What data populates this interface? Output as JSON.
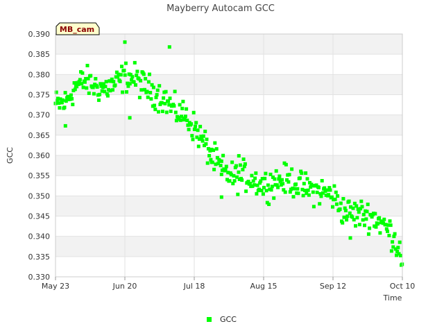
{
  "chart_data": {
    "type": "scatter",
    "title": "Mayberry Autocam GCC",
    "xlabel": "Time",
    "ylabel": "GCC",
    "site_tag": "MB_cam",
    "x_range": [
      "2023-05-23",
      "2023-10-10"
    ],
    "ylim": [
      0.33,
      0.39
    ],
    "y_ticks": [
      "0.330",
      "0.335",
      "0.340",
      "0.345",
      "0.350",
      "0.355",
      "0.360",
      "0.365",
      "0.370",
      "0.375",
      "0.380",
      "0.385",
      "0.390"
    ],
    "x_ticks": [
      {
        "date": "2023-05-23",
        "label": "May 23"
      },
      {
        "date": "2023-06-20",
        "label": "Jun 20"
      },
      {
        "date": "2023-07-18",
        "label": "Jul 18"
      },
      {
        "date": "2023-08-15",
        "label": "Aug 15"
      },
      {
        "date": "2023-09-12",
        "label": "Sep 12"
      },
      {
        "date": "2023-10-10",
        "label": "Oct 10"
      }
    ],
    "grid": true,
    "legend": "bottom-center",
    "colors": {
      "series": "#00ff00",
      "band": "#f2f2f2"
    },
    "series": [
      {
        "name": "GCC",
        "trend": [
          [
            "2023-05-23",
            0.3725
          ],
          [
            "2023-05-27",
            0.373
          ],
          [
            "2023-05-31",
            0.377
          ],
          [
            "2023-06-04",
            0.3785
          ],
          [
            "2023-06-08",
            0.377
          ],
          [
            "2023-06-12",
            0.3765
          ],
          [
            "2023-06-16",
            0.3775
          ],
          [
            "2023-06-20",
            0.3795
          ],
          [
            "2023-06-24",
            0.379
          ],
          [
            "2023-06-28",
            0.377
          ],
          [
            "2023-07-02",
            0.3755
          ],
          [
            "2023-07-06",
            0.374
          ],
          [
            "2023-07-10",
            0.371
          ],
          [
            "2023-07-14",
            0.37
          ],
          [
            "2023-07-18",
            0.367
          ],
          [
            "2023-07-22",
            0.363
          ],
          [
            "2023-07-26",
            0.359
          ],
          [
            "2023-07-30",
            0.356
          ],
          [
            "2023-08-03",
            0.3545
          ],
          [
            "2023-08-07",
            0.355
          ],
          [
            "2023-08-11",
            0.354
          ],
          [
            "2023-08-15",
            0.3525
          ],
          [
            "2023-08-19",
            0.3535
          ],
          [
            "2023-08-23",
            0.354
          ],
          [
            "2023-08-27",
            0.3535
          ],
          [
            "2023-08-31",
            0.352
          ],
          [
            "2023-09-04",
            0.3515
          ],
          [
            "2023-09-08",
            0.351
          ],
          [
            "2023-09-12",
            0.35
          ],
          [
            "2023-09-16",
            0.3465
          ],
          [
            "2023-09-20",
            0.3455
          ],
          [
            "2023-09-24",
            0.3455
          ],
          [
            "2023-09-28",
            0.345
          ],
          [
            "2023-10-02",
            0.343
          ],
          [
            "2023-10-06",
            0.3405
          ],
          [
            "2023-10-10",
            0.335
          ]
        ],
        "scatter": 0.003,
        "outliers": [
          [
            "2023-06-20",
            0.388
          ],
          [
            "2023-07-08",
            0.3868
          ],
          [
            "2023-07-29",
            0.3497
          ],
          [
            "2023-09-19",
            0.3396
          ],
          [
            "2023-07-25",
            0.3583
          ],
          [
            "2023-06-22",
            0.3693
          ],
          [
            "2023-05-27",
            0.3673
          ],
          [
            "2023-07-29",
            0.3553
          ],
          [
            "2023-08-05",
            0.3599
          ]
        ]
      }
    ]
  }
}
